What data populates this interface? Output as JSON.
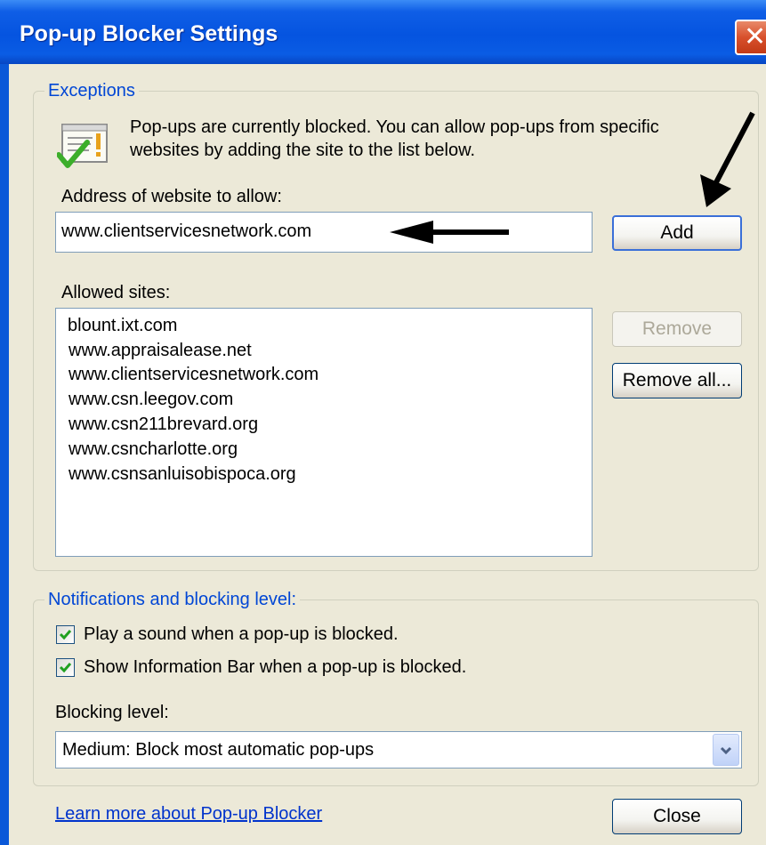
{
  "window": {
    "title": "Pop-up Blocker Settings",
    "close_glyph": "✕"
  },
  "exceptions": {
    "legend": "Exceptions",
    "icon": "popup-warning-icon",
    "info_line1": "Pop-ups are currently blocked.  You can allow pop-ups from specific",
    "info_line2": "websites by adding the site to the list below.",
    "address_label": "Address of website to allow:",
    "address_value": "www.clientservicesnetwork.com",
    "add_label": "Add",
    "allowed_label": "Allowed sites:",
    "allowed_sites": [
      "blount.ixt.com",
      "www.appraisalease.net",
      "www.clientservicesnetwork.com",
      "www.csn.leegov.com",
      "www.csn211brevard.org",
      "www.csncharlotte.org",
      "www.csnsanluisobispoca.org"
    ],
    "remove_label": "Remove",
    "remove_all_label": "Remove all..."
  },
  "notifications": {
    "legend": "Notifications and blocking level:",
    "play_sound_label": "Play a sound when a pop-up is blocked.",
    "play_sound_checked": true,
    "info_bar_label": "Show Information Bar when a pop-up is blocked.",
    "info_bar_checked": true,
    "blocking_level_label": "Blocking level:",
    "blocking_level_value": "Medium: Block most automatic pop-ups"
  },
  "footer": {
    "learn_more": "Learn more about Pop-up Blocker",
    "close_label": "Close"
  },
  "colors": {
    "titlebar": "#0554e0",
    "dialog_bg": "#ece9d8",
    "legend_text": "#0046d5",
    "link": "#0033cc"
  }
}
